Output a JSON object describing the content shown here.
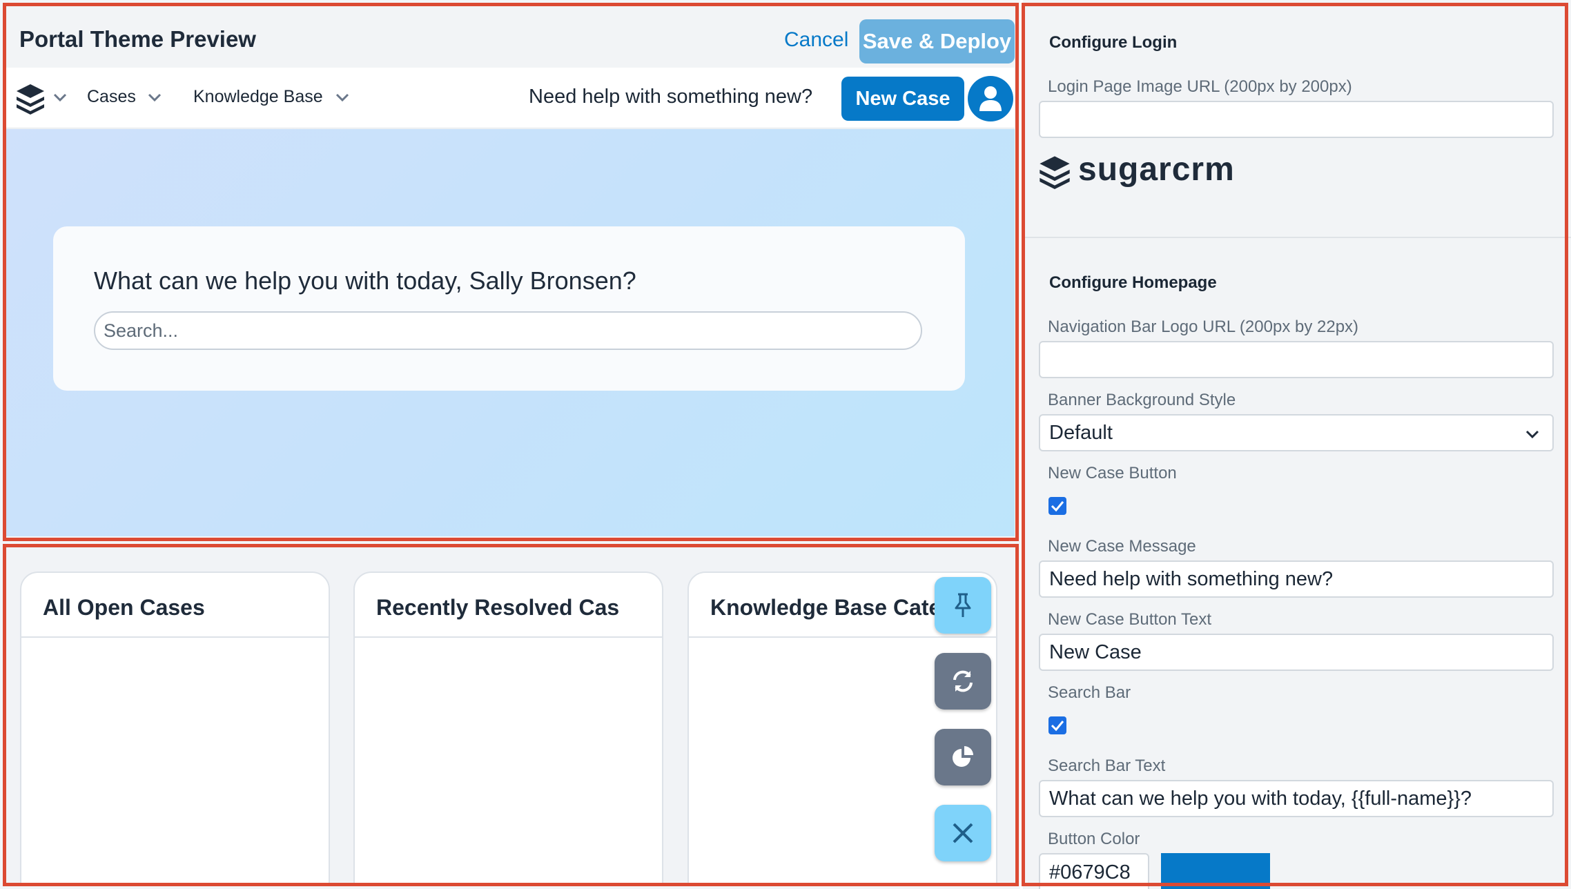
{
  "preview": {
    "title": "Portal Theme Preview",
    "cancel_label": "Cancel",
    "deploy_label": "Save & Deploy",
    "nav": {
      "logo_icon": "layers-logo-icon",
      "menus": [
        "Cases",
        "Knowledge Base"
      ],
      "help_text": "Need help with something new?",
      "new_case_label": "New Case",
      "avatar_icon": "user-icon"
    },
    "banner": {
      "question": "What can we help you with today, Sally Bronsen?",
      "search_placeholder": "Search..."
    },
    "dashlets": [
      {
        "title": "All Open Cases"
      },
      {
        "title": "Recently Resolved Cases"
      },
      {
        "title": "Knowledge Base Categories"
      }
    ],
    "fab_icons": [
      "pin-icon",
      "refresh-icon",
      "pie-chart-icon",
      "close-icon"
    ]
  },
  "config": {
    "login": {
      "section_title": "Configure Login",
      "image_url_label": "Login Page Image URL (200px by 200px)",
      "image_url_value": "",
      "logo_text": "sugarcrm"
    },
    "homepage": {
      "section_title": "Configure Homepage",
      "nav_logo_label": "Navigation Bar Logo URL (200px by 22px)",
      "nav_logo_value": "",
      "banner_style_label": "Banner Background Style",
      "banner_style_value": "Default",
      "new_case_button_label": "New Case Button",
      "new_case_button_checked": true,
      "new_case_message_label": "New Case Message",
      "new_case_message_value": "Need help with something new?",
      "new_case_button_text_label": "New Case Button Text",
      "new_case_button_text_value": "New Case",
      "search_bar_label": "Search Bar",
      "search_bar_checked": true,
      "search_bar_text_label": "Search Bar Text",
      "search_bar_text_value": "What can we help you with today, {{full-name}}?",
      "button_color_label": "Button Color",
      "button_color_value": "#0679C8"
    }
  },
  "colors": {
    "accent": "#0679c8",
    "deploy_button": "#6bb1de",
    "annotation_frame": "#dc4a33",
    "fab_light": "#7fd3fa",
    "fab_dark": "#6a778a"
  }
}
